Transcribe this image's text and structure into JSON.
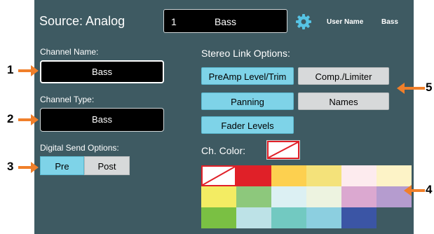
{
  "header": {
    "title": "Source: Analog",
    "channel_number": "1",
    "channel_name": "Bass",
    "user_name_label": "User Name",
    "user_name_value": "Bass"
  },
  "left": {
    "channel_name_label": "Channel Name:",
    "channel_name_value": "Bass",
    "channel_type_label": "Channel Type:",
    "channel_type_value": "Bass",
    "digital_send_label": "Digital Send Options:",
    "pre_label": "Pre",
    "post_label": "Post"
  },
  "stereo": {
    "heading": "Stereo Link Options:",
    "buttons": [
      {
        "label": "PreAmp Level/Trim",
        "active": true
      },
      {
        "label": "Comp./Limiter",
        "active": false
      },
      {
        "label": "Panning",
        "active": true
      },
      {
        "label": "Names",
        "active": false
      },
      {
        "label": "Fader Levels",
        "active": true
      }
    ]
  },
  "color": {
    "label": "Ch. Color:",
    "swatches": [
      "none",
      "#e02028",
      "#fdd04f",
      "#f4e27a",
      "#fdebee",
      "#fdf3c7",
      "#f3ec63",
      "#8dc87c",
      "#dcf0f3",
      "#edf3e0",
      "#dba8d0",
      "#b59ccf",
      "#7ac043",
      "#bde2e7",
      "#72c9c1",
      "#8ccfe0",
      "#3b55a5"
    ]
  },
  "callouts": [
    "1",
    "2",
    "3",
    "4",
    "5"
  ],
  "colors": {
    "panel": "#3e5a62",
    "active_button": "#7ed3e8",
    "inactive_button": "#d7d9da",
    "arrow": "#f07f2a"
  }
}
